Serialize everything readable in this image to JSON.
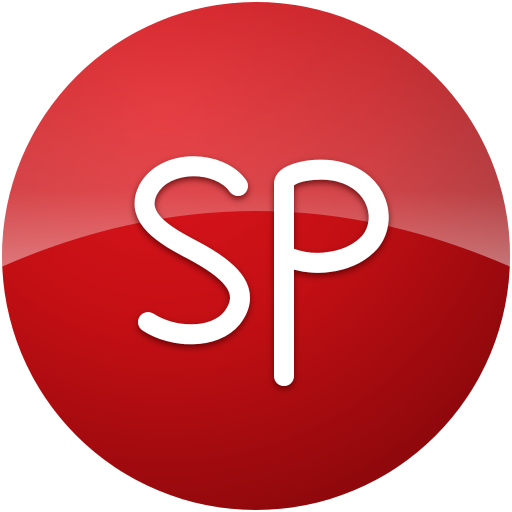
{
  "logo": {
    "monogram": "SP",
    "colors": {
      "disc_light": "#e0161c",
      "disc_mid": "#c30f14",
      "disc_dark": "#7e0609",
      "letters": "#ffffff",
      "letter_shadow": "#4a0003"
    }
  }
}
